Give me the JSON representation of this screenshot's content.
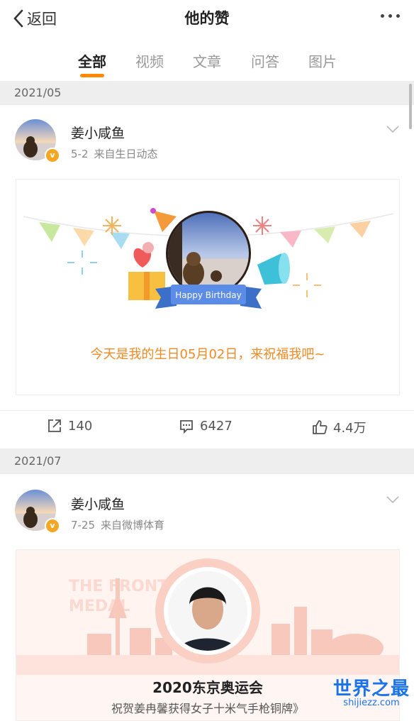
{
  "header": {
    "back_label": "返回",
    "title": "他的赞"
  },
  "tabs": [
    {
      "label": "全部"
    },
    {
      "label": "视频"
    },
    {
      "label": "文章"
    },
    {
      "label": "问答"
    },
    {
      "label": "图片"
    }
  ],
  "colors": {
    "accent": "#ff8a00",
    "badge": "#f5a623",
    "birthday_text": "#f08a24"
  },
  "posts": [
    {
      "section_date": "2021/05",
      "user": "姜小咸鱼",
      "date": "5-2",
      "source": "来自生日动态",
      "card_text": "今天是我的生日05月02日，来祝福我吧~",
      "ribbon": "Happy Birthday",
      "shares": "140",
      "comments": "6427",
      "likes": "4.4万"
    },
    {
      "section_date": "2021/07",
      "user": "姜小咸鱼",
      "date": "7-25",
      "source": "来自微博体育",
      "card_title": "2020东京奥运会",
      "card_sub": "祝贺姜冉馨获得女子十米气手枪铜牌》",
      "bg_text_1": "THE FRONT",
      "bg_text_2": "MEDAL"
    }
  ],
  "watermark": {
    "title": "世界之最",
    "site": "shijiezz.com"
  }
}
